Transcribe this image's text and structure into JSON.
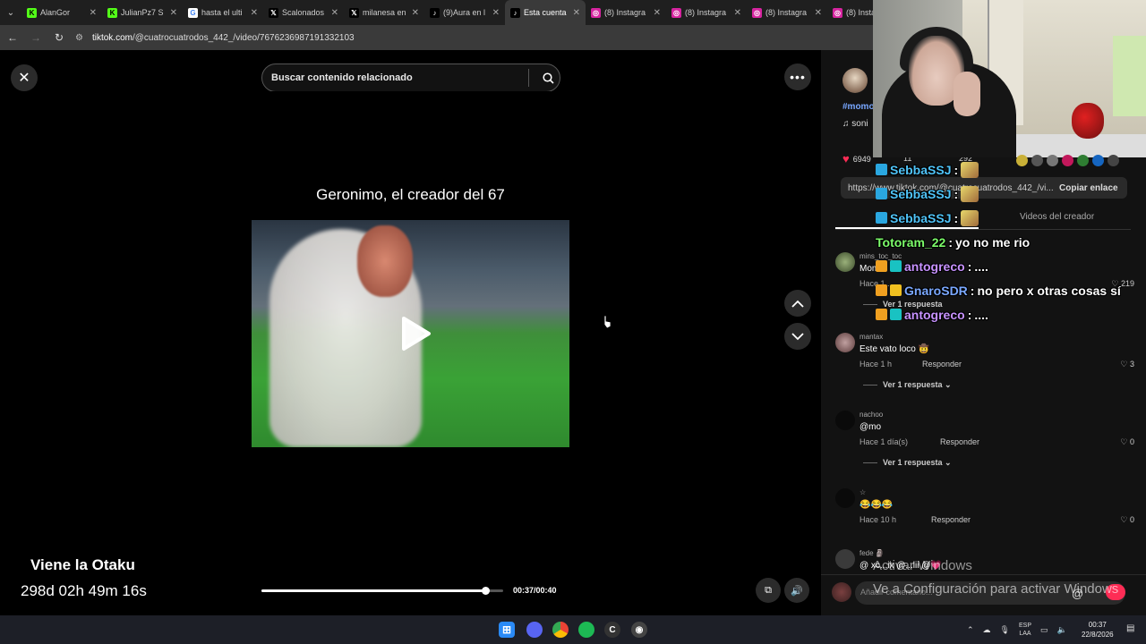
{
  "browser": {
    "tabs": [
      {
        "title": "AlanGor",
        "icon": "kick-icon",
        "active": false
      },
      {
        "title": "JulianPz7 S",
        "icon": "kick-icon",
        "active": false
      },
      {
        "title": "hasta el ulti",
        "icon": "google-icon",
        "active": false
      },
      {
        "title": "Scalonados",
        "icon": "x-icon",
        "active": false
      },
      {
        "title": "milanesa en",
        "icon": "x-icon",
        "active": false
      },
      {
        "title": "(9)Aura en l",
        "icon": "tiktok-icon",
        "active": false
      },
      {
        "title": "Esta cuenta",
        "icon": "tiktok-icon",
        "active": true
      },
      {
        "title": "(8) Instagra",
        "icon": "instagram-icon",
        "active": false
      },
      {
        "title": "(8) Instagra",
        "icon": "instagram-icon",
        "active": false
      },
      {
        "title": "(8) Instagra",
        "icon": "instagram-icon",
        "active": false
      },
      {
        "title": "(8) Insta",
        "icon": "instagram-icon",
        "active": false
      }
    ],
    "url_host": "tiktok.com",
    "url_path": "/@cuatrocuatrodos_442_/video/7676236987191332103"
  },
  "tiktok": {
    "search_placeholder": "Buscar contenido relacionado",
    "video_caption": "Geronimo, el creador del 67",
    "time": "00:37/00:40",
    "progress": 0.925,
    "side": {
      "hashtag": "#momo",
      "sound": "♫  soni",
      "likes": "6949",
      "comments": "11",
      "saves": "292",
      "link": "https://www.tiktok.com/@cuatrocuatrodos_442_/vi...",
      "copy_link": "Copiar enlace",
      "tab_creator": "Videos del creador"
    },
    "comments": [
      {
        "user": "mantax",
        "text": "Este vato loco 🤠",
        "time": "Hace 1 h",
        "reply": "Responder",
        "likes": "3",
        "more": "Ver 1 respuesta ⌄"
      },
      {
        "user": "nachoo",
        "text": "@mo",
        "time": "Hace 1 día(s)",
        "reply": "Responder",
        "likes": "0",
        "more": "Ver 1 respuesta ⌄"
      },
      {
        "user": "☆",
        "text": "😂😂😂",
        "time": "Hace 10 h",
        "reply": "Responder",
        "likes": "0",
        "more": ""
      },
      {
        "user": "fede 🗿",
        "text": "@ xc...ix @...lii @💗",
        "time": "",
        "reply": "",
        "likes": "",
        "more": ""
      }
    ],
    "partial_comment": {
      "user": "mins_toc_toc",
      "text": "Mom...",
      "time": "Hace 1...",
      "likes": "219",
      "more": "Ver 1 respuesta"
    },
    "add_comment_placeholder": "Añadir comentario..."
  },
  "overlay": {
    "stream_title": "Viene la Otaku",
    "stream_timer": "298d 02h 49m 16s",
    "watermark_line1": "Activar Windows",
    "watermark_line2": "Ve a Configuración para activar Windows",
    "chat": [
      {
        "user": "SebbaSSJ",
        "color": "#4fc3f7",
        "message": "",
        "emote": true
      },
      {
        "user": "SebbaSSJ",
        "color": "#4fc3f7",
        "message": "",
        "emote": true
      },
      {
        "user": "SebbaSSJ",
        "color": "#4fc3f7",
        "message": "",
        "emote": true
      },
      {
        "user": "Totoram_22",
        "color": "#7cfc6a",
        "message": "yo no me rio",
        "emote": false
      },
      {
        "user": "antogreco",
        "color": "#c792ff",
        "message": "....",
        "emote": false
      },
      {
        "user": "GnaroSDR",
        "color": "#7aa8ff",
        "message": "no pero x otras cosas sí",
        "emote": false
      },
      {
        "user": "antogreco",
        "color": "#c792ff",
        "message": "....",
        "emote": false
      }
    ]
  },
  "taskbar": {
    "lang_line1": "ESP",
    "lang_line2": "LAA",
    "time": "00:37",
    "date": "22/8/2026"
  }
}
